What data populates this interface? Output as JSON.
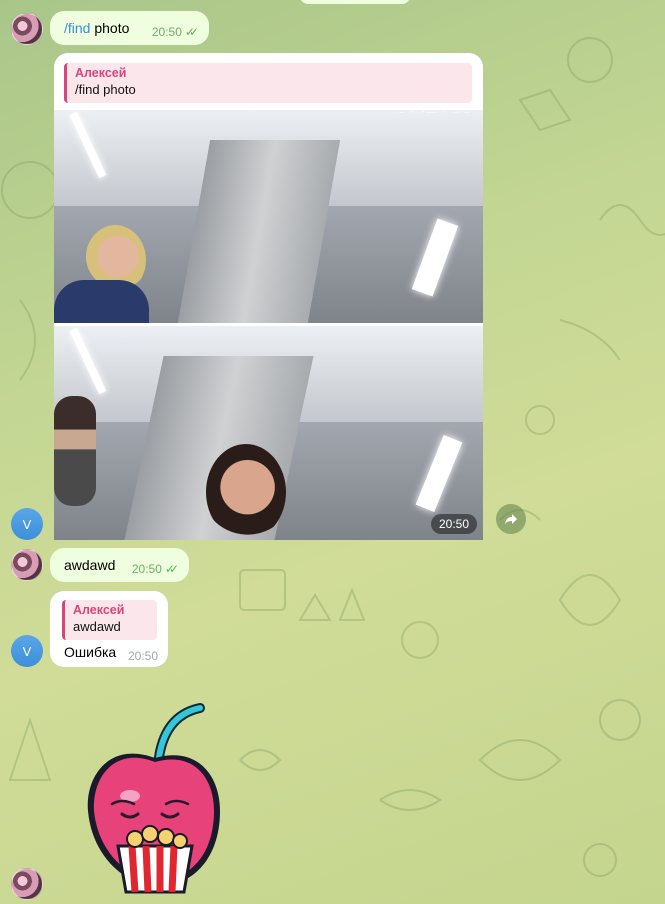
{
  "messages": {
    "find_cmd": {
      "command": "/find",
      "text": " photo",
      "time": "20:50"
    },
    "photo_reply": {
      "quote_name": "Алексей",
      "quote_text": "/find photo",
      "time": "20:50"
    },
    "awdawd": {
      "text": "awdawd",
      "time": "20:50"
    },
    "error_reply": {
      "quote_name": "Алексей",
      "quote_text": "awdawd",
      "text": "Ошибка",
      "time": "20:50"
    }
  },
  "avatars": {
    "bot_letter": "V"
  },
  "colors": {
    "outgoing_bubble": "#eefedf",
    "incoming_bubble": "#ffffff",
    "quote_accent": "#d6467a",
    "command_link": "#3a8fd3",
    "read_check": "#5fb15a"
  },
  "icons": [
    "double-check-icon",
    "forward-icon",
    "cherry-sticker"
  ]
}
